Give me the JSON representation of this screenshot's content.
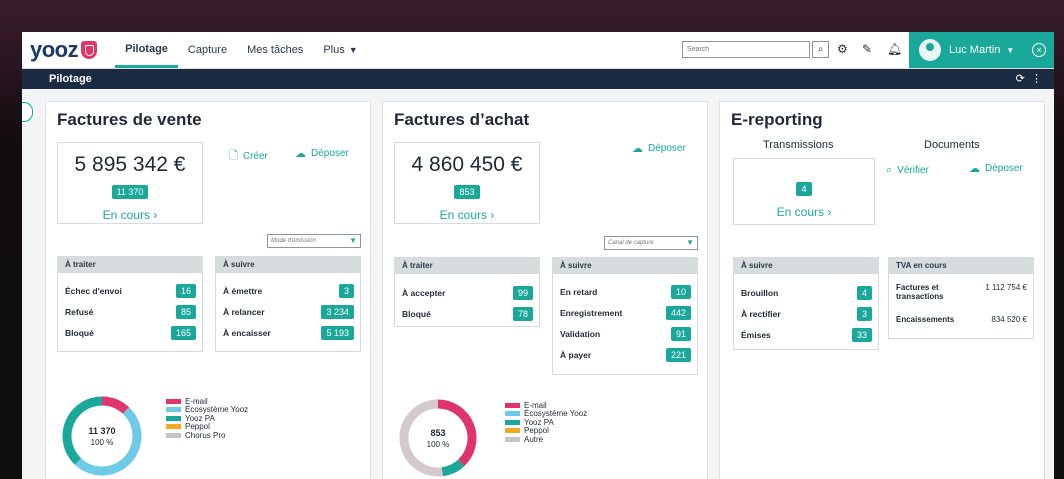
{
  "colors": {
    "accent": "#1aa89b",
    "navy": "#1b2b42",
    "pink": "#e0356a",
    "light_blue": "#6dcbe8",
    "orange": "#f5a623",
    "grey": "#c4c4c4"
  },
  "app": {
    "logo": "yooz"
  },
  "nav": {
    "items": [
      {
        "label": "Pilotage",
        "active": true
      },
      {
        "label": "Capture"
      },
      {
        "label": "Mes tâches"
      },
      {
        "label": "Plus"
      }
    ]
  },
  "search": {
    "placeholder": "Search"
  },
  "user": {
    "name": "Luc Martin"
  },
  "subbar": {
    "title": "Pilotage"
  },
  "ventes": {
    "title": "Factures de vente",
    "amount": "5 895 342 €",
    "count": "11 370",
    "status": "En cours",
    "actions": {
      "create": "Créer",
      "upload": "Déposer"
    },
    "dropdown": "Mode d'émission",
    "a_traiter": {
      "title": "À traiter",
      "rows": [
        {
          "label": "Échec d'envoi",
          "value": "16"
        },
        {
          "label": "Refusé",
          "value": "85"
        },
        {
          "label": "Bloqué",
          "value": "165"
        }
      ]
    },
    "a_suivre": {
      "title": "À suivre",
      "rows": [
        {
          "label": "À émettre",
          "value": "3"
        },
        {
          "label": "À relancer",
          "value": "3 234"
        },
        {
          "label": "À encaisser",
          "value": "5 193"
        }
      ]
    },
    "donut": {
      "total": "11 370",
      "pct": "100 %"
    },
    "legend": [
      "E-mail",
      "Écosystème Yooz",
      "Yooz PA",
      "Peppol",
      "Chorus Pro"
    ]
  },
  "achats": {
    "title": "Factures d’achat",
    "amount": "4 860 450 €",
    "count": "853",
    "status": "En cours",
    "actions": {
      "upload": "Déposer"
    },
    "dropdown": "Canal de capture",
    "a_traiter": {
      "title": "À traiter",
      "rows": [
        {
          "label": "À accepter",
          "value": "99"
        },
        {
          "label": "Bloqué",
          "value": "78"
        }
      ]
    },
    "a_suivre": {
      "title": "À suivre",
      "rows": [
        {
          "label": "En retard",
          "value": "10"
        },
        {
          "label": "Enregistrement",
          "value": "442"
        },
        {
          "label": "Validation",
          "value": "91"
        },
        {
          "label": "À payer",
          "value": "221"
        }
      ]
    },
    "donut": {
      "total": "853",
      "pct": "100 %"
    },
    "legend": [
      "E-mail",
      "Écosystème Yooz",
      "Yooz PA",
      "Peppol",
      "Autre"
    ]
  },
  "ereporting": {
    "title": "E-reporting",
    "transmissions": "Transmissions",
    "documents": "Documents",
    "count": "4",
    "status": "En cours",
    "actions": {
      "verify": "Vérifier",
      "upload": "Déposer"
    },
    "a_suivre": {
      "title": "À suivre",
      "rows": [
        {
          "label": "Brouillon",
          "value": "4"
        },
        {
          "label": "À rectifier",
          "value": "3"
        },
        {
          "label": "Émises",
          "value": "33"
        }
      ]
    },
    "tva": {
      "title": "TVA en cours",
      "rows": [
        {
          "label": "Factures et transactions",
          "value": "1 112 754 €"
        },
        {
          "label": "Encaissements",
          "value": "834 520 €"
        }
      ]
    }
  },
  "chart_data": [
    {
      "type": "pie",
      "title": "",
      "center": "11 370",
      "series": [
        {
          "name": "E-mail",
          "value": 12
        },
        {
          "name": "Écosystème Yooz",
          "value": 50
        },
        {
          "name": "Yooz PA",
          "value": 38
        }
      ]
    },
    {
      "type": "pie",
      "title": "",
      "center": "853",
      "series": [
        {
          "name": "E-mail",
          "value": 38
        },
        {
          "name": "Yooz PA",
          "value": 10
        },
        {
          "name": "Autre",
          "value": 52
        }
      ]
    }
  ]
}
